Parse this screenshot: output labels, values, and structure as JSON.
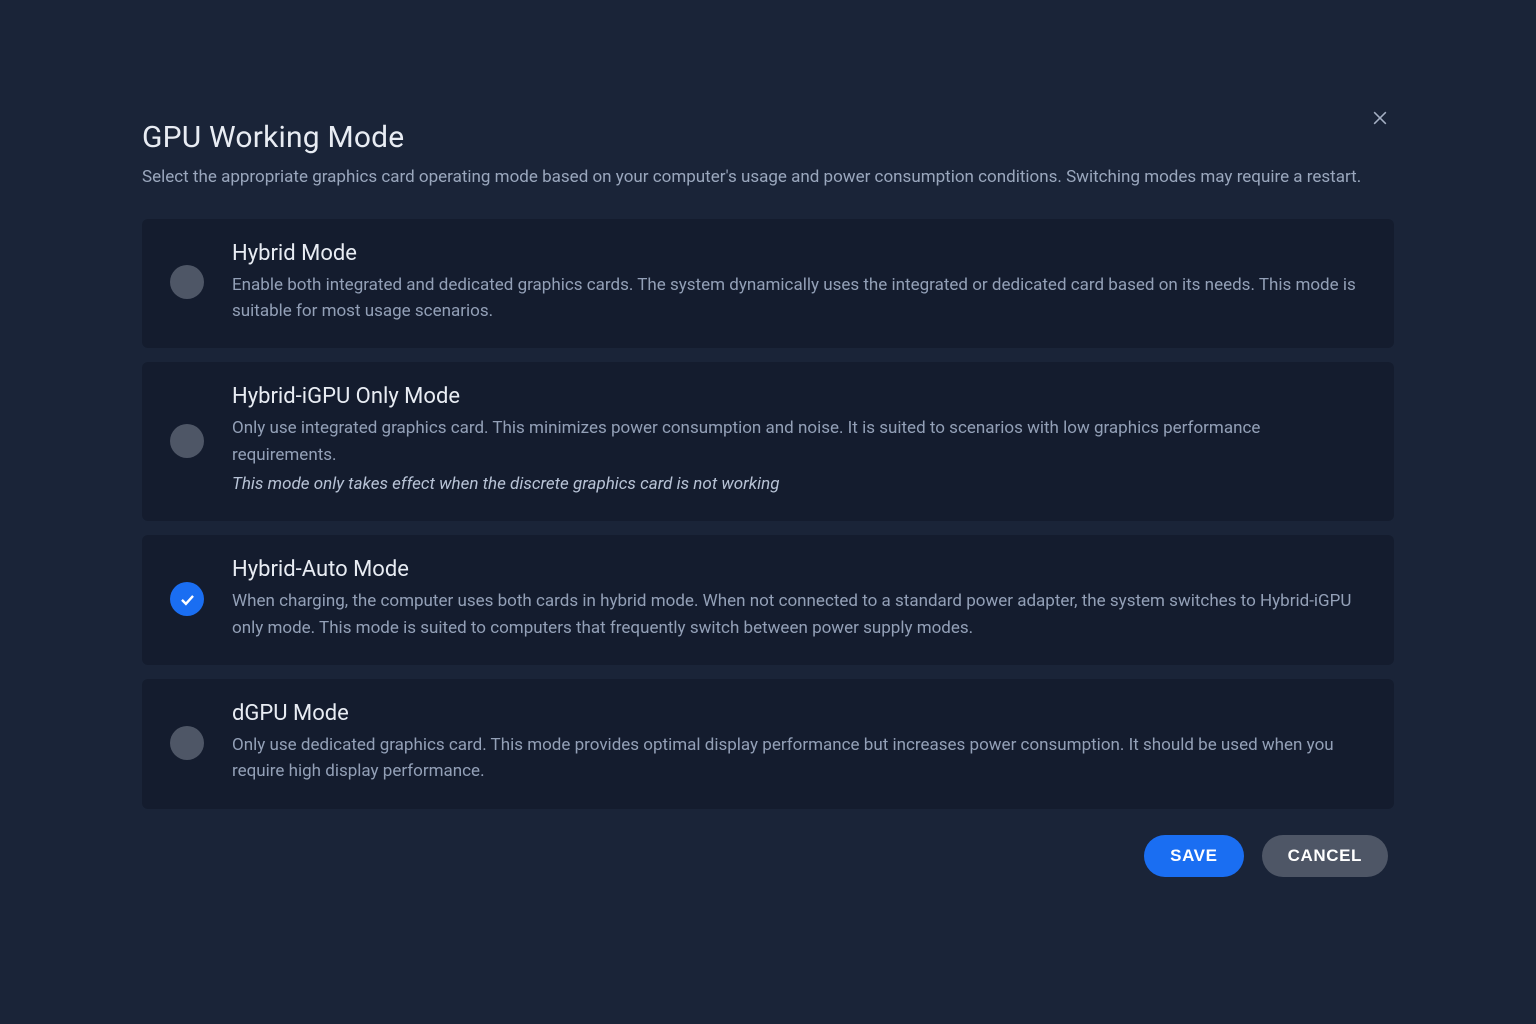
{
  "dialog": {
    "title": "GPU Working Mode",
    "subtitle": "Select the appropriate graphics card operating mode based on your computer's usage and power consumption conditions. Switching modes may require a restart."
  },
  "options": [
    {
      "id": "hybrid",
      "title": "Hybrid Mode",
      "desc": "Enable both integrated and dedicated graphics cards. The system dynamically uses the integrated or dedicated card based on its needs. This mode is suitable for most usage scenarios.",
      "note": "",
      "selected": false
    },
    {
      "id": "hybrid-igpu",
      "title": "Hybrid-iGPU Only Mode",
      "desc": "Only use integrated graphics card. This minimizes power consumption and noise. It is suited to scenarios with low graphics performance requirements.",
      "note": "This mode only takes effect when the discrete graphics card is not working",
      "selected": false
    },
    {
      "id": "hybrid-auto",
      "title": "Hybrid-Auto Mode",
      "desc": "When charging, the computer uses both cards in hybrid mode. When not connected to a standard power adapter, the system switches to Hybrid-iGPU only mode. This mode is suited to computers that frequently switch between power supply modes.",
      "note": "",
      "selected": true
    },
    {
      "id": "dgpu",
      "title": "dGPU Mode",
      "desc": "Only use dedicated graphics card. This mode provides optimal display performance but increases power consumption. It should be used when you require high display performance.",
      "note": "",
      "selected": false
    }
  ],
  "footer": {
    "save_label": "SAVE",
    "cancel_label": "CANCEL"
  }
}
